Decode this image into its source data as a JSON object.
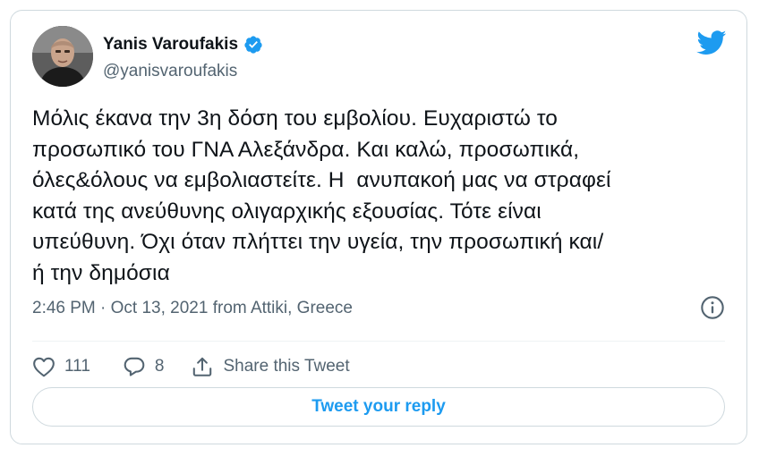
{
  "author": {
    "display_name": "Yanis Varoufakis",
    "handle": "@yanisvaroufakis",
    "verified": true
  },
  "icons": {
    "brand": "twitter-bird-icon",
    "verified": "verified-badge-icon",
    "info": "info-icon",
    "like": "heart-icon",
    "reply": "reply-bubble-icon",
    "share": "share-icon"
  },
  "tweet": {
    "text": "Μόλις έκανα την 3η δόση του εμβολίου. Ευχαριστώ το\nπροσωπικό του ΓΝΑ Αλεξάνδρα. Και καλώ, προσωπικά,\nόλες&όλους να εμβολιαστείτε. Η  ανυπακοή μας να στραφεί\nκατά της ανεύθυνης ολιγαρχικής εξουσίας. Τότε είναι\nυπεύθυνη. Όχι όταν πλήττει την υγεία, την προσωπική και/\nή την δημόσια",
    "meta": "2:46 PM · Oct 13, 2021 from Attiki, Greece"
  },
  "actions": {
    "like_count": "111",
    "reply_count": "8",
    "share_label": "Share this Tweet"
  },
  "reply_button_label": "Tweet your reply",
  "colors": {
    "accent": "#1d9bf0",
    "text": "#0f1419",
    "muted": "#536471",
    "border": "#cfd9de"
  }
}
